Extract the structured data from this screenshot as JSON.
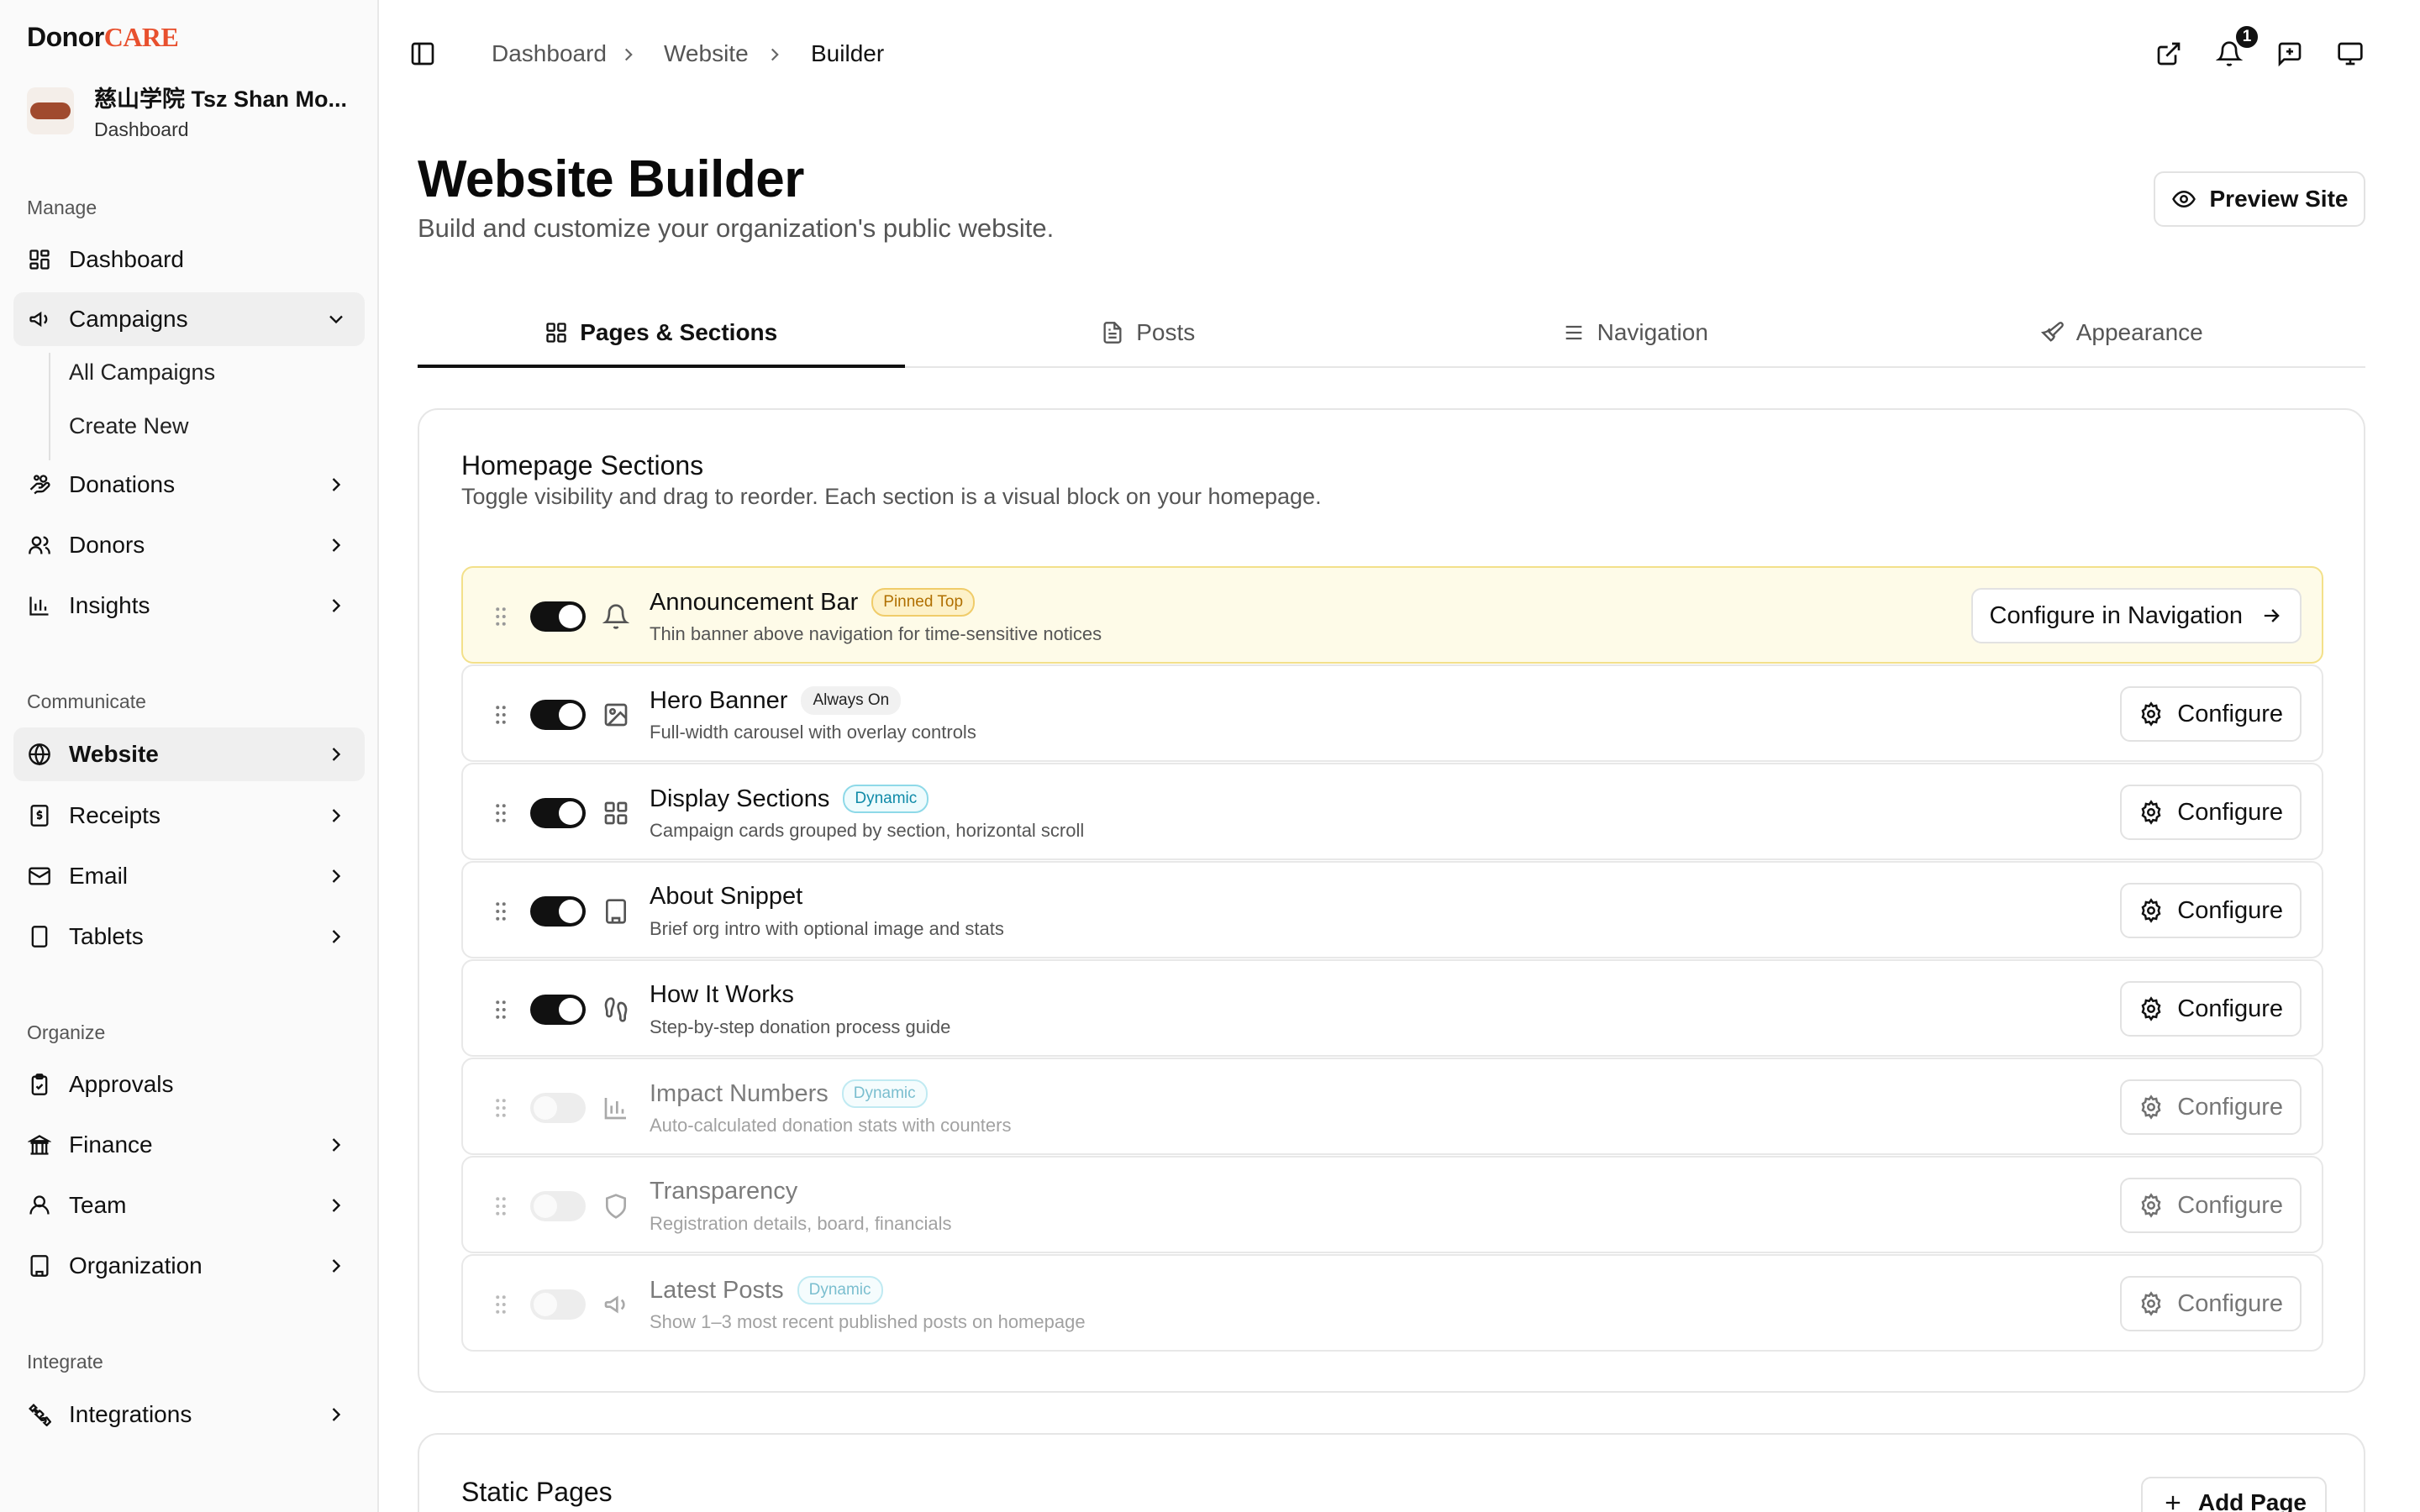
{
  "brand": {
    "donor": "Donor",
    "care": "CARE"
  },
  "org": {
    "name": "慈山学院 Tsz Shan Mo...",
    "sub": "Dashboard"
  },
  "sidebar": {
    "sections": [
      "Manage",
      "Communicate",
      "Organize",
      "Integrate"
    ],
    "items": [
      {
        "label": "Dashboard",
        "icon": "grid-icon"
      },
      {
        "label": "Campaigns",
        "icon": "megaphone-icon",
        "expanded": true
      },
      {
        "label": "Donations",
        "icon": "hand-coins-icon"
      },
      {
        "label": "Donors",
        "icon": "users-icon"
      },
      {
        "label": "Insights",
        "icon": "bar-chart-icon"
      },
      {
        "label": "Website",
        "icon": "globe-icon",
        "active": true
      },
      {
        "label": "Receipts",
        "icon": "receipt-icon"
      },
      {
        "label": "Email",
        "icon": "mail-icon"
      },
      {
        "label": "Tablets",
        "icon": "tablet-icon"
      },
      {
        "label": "Approvals",
        "icon": "clipboard-check-icon"
      },
      {
        "label": "Finance",
        "icon": "bank-icon"
      },
      {
        "label": "Team",
        "icon": "user-icon"
      },
      {
        "label": "Organization",
        "icon": "building-icon"
      },
      {
        "label": "Integrations",
        "icon": "puzzle-icon"
      }
    ],
    "sub_items": [
      "All Campaigns",
      "Create New"
    ]
  },
  "breadcrumb": [
    "Dashboard",
    "Website",
    "Builder"
  ],
  "notifications": {
    "count": "1"
  },
  "page": {
    "title": "Website Builder",
    "subtitle": "Build and customize your organization's public website.",
    "preview_label": "Preview Site"
  },
  "tabs": [
    {
      "label": "Pages & Sections",
      "icon": "layout-grid-icon",
      "active": true
    },
    {
      "label": "Posts",
      "icon": "file-text-icon"
    },
    {
      "label": "Navigation",
      "icon": "menu-icon"
    },
    {
      "label": "Appearance",
      "icon": "paintbrush-icon"
    }
  ],
  "homepage": {
    "title": "Homepage Sections",
    "subtitle": "Toggle visibility and drag to reorder. Each section is a visual block on your homepage.",
    "sections": [
      {
        "title": "Announcement Bar",
        "tag": "Pinned Top",
        "tag_type": "pinned",
        "desc": "Thin banner above navigation for time-sensitive notices",
        "enabled": true,
        "icon": "bell-icon",
        "button": "Configure in Navigation"
      },
      {
        "title": "Hero Banner",
        "tag": "Always On",
        "tag_type": "always",
        "desc": "Full-width carousel with overlay controls",
        "enabled": true,
        "icon": "image-icon",
        "button": "Configure"
      },
      {
        "title": "Display Sections",
        "tag": "Dynamic",
        "tag_type": "dynamic",
        "desc": "Campaign cards grouped by section, horizontal scroll",
        "enabled": true,
        "icon": "layout-grid-icon",
        "button": "Configure"
      },
      {
        "title": "About Snippet",
        "tag": "",
        "tag_type": "",
        "desc": "Brief org intro with optional image and stats",
        "enabled": true,
        "icon": "building-icon",
        "button": "Configure"
      },
      {
        "title": "How It Works",
        "tag": "",
        "tag_type": "",
        "desc": "Step-by-step donation process guide",
        "enabled": true,
        "icon": "footprints-icon",
        "button": "Configure"
      },
      {
        "title": "Impact Numbers",
        "tag": "Dynamic",
        "tag_type": "dynamic",
        "desc": "Auto-calculated donation stats with counters",
        "enabled": false,
        "icon": "bar-chart-icon",
        "button": "Configure"
      },
      {
        "title": "Transparency",
        "tag": "",
        "tag_type": "",
        "desc": "Registration details, board, financials",
        "enabled": false,
        "icon": "shield-icon",
        "button": "Configure"
      },
      {
        "title": "Latest Posts",
        "tag": "Dynamic",
        "tag_type": "dynamic",
        "desc": "Show 1–3 most recent published posts on homepage",
        "enabled": false,
        "icon": "megaphone-icon",
        "button": "Configure"
      }
    ]
  },
  "static_pages": {
    "title": "Static Pages",
    "add_label": "Add Page"
  }
}
